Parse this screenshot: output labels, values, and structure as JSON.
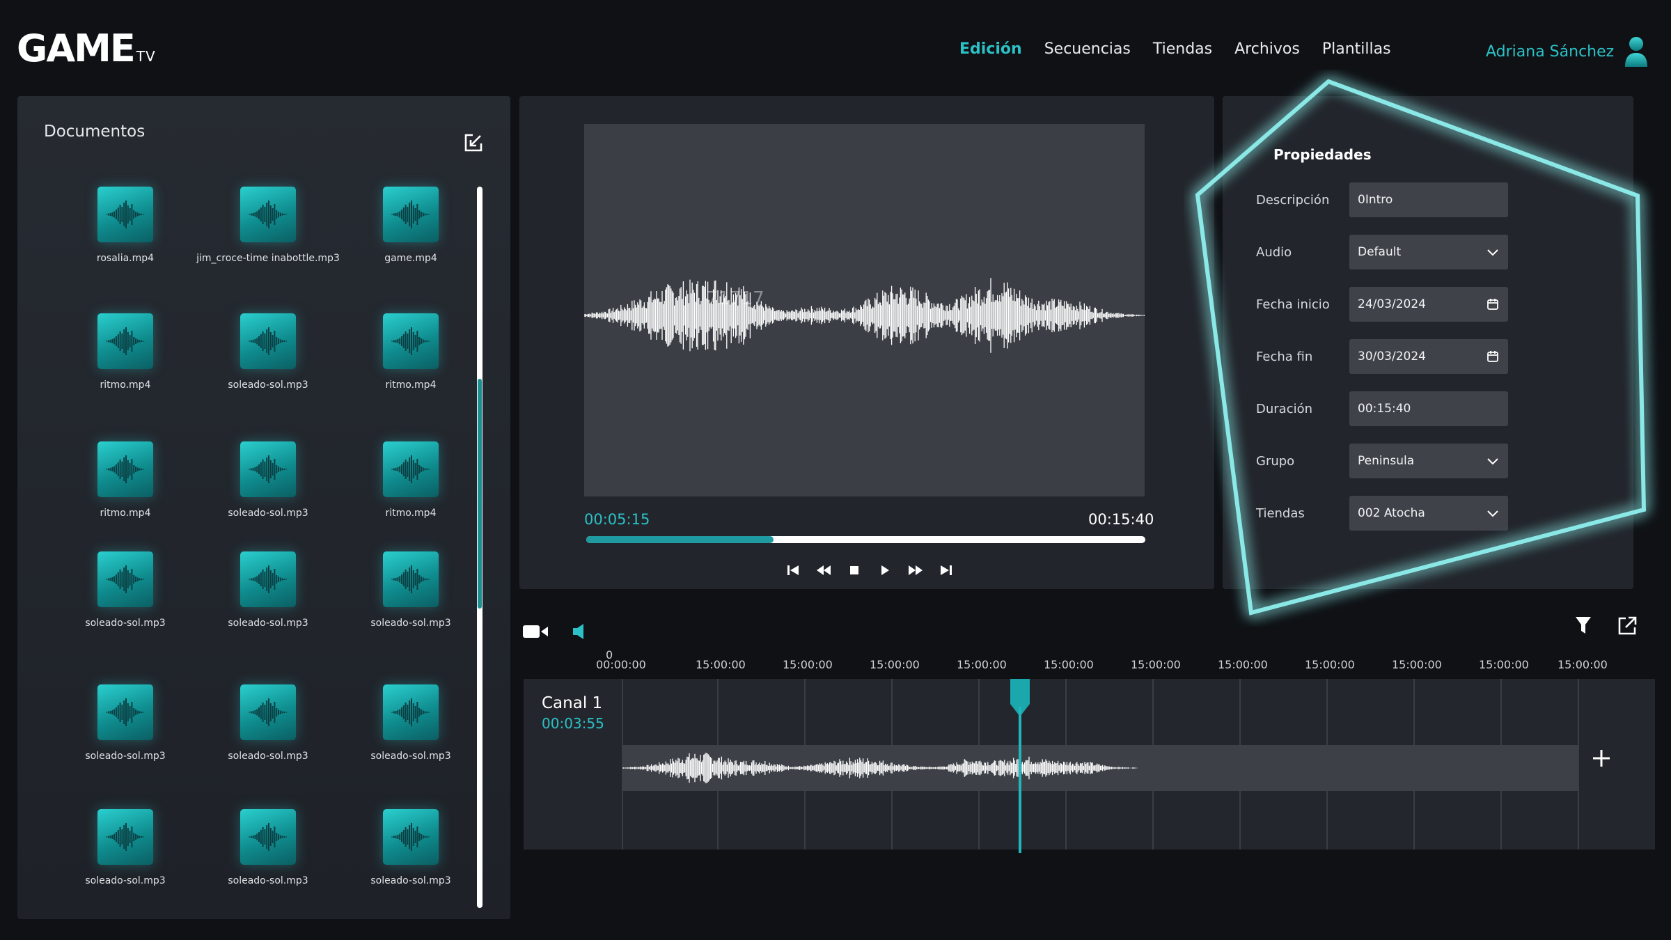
{
  "header": {
    "logo_main": "GAME",
    "logo_sub": "TV",
    "nav": [
      "Edición",
      "Secuencias",
      "Tiendas",
      "Archivos",
      "Plantillas"
    ],
    "active_nav": "Edición",
    "user_name": "Adriana Sánchez",
    "accent_color": "#2bc1c6"
  },
  "documents": {
    "title": "Documentos",
    "files": [
      "rosalia.mp4",
      "jim_croce-time inabottle.mp3",
      "game.mp4",
      "ritmo.mp4",
      "soleado-sol.mp3",
      "ritmo.mp4",
      "ritmo.mp4",
      "soleado-sol.mp3",
      "ritmo.mp4",
      "soleado-sol.mp3",
      "soleado-sol.mp3",
      "soleado-sol.mp3",
      "soleado-sol.mp3",
      "soleado-sol.mp3",
      "soleado-sol.mp3",
      "soleado-sol.mp3",
      "soleado-sol.mp3",
      "soleado-sol.mp3"
    ],
    "scroll_position": 0.27
  },
  "player": {
    "overlay_number": "71717",
    "current_time": "00:05:15",
    "total_time": "00:15:40",
    "progress": 0.335,
    "controls": [
      "skip-back-icon",
      "rewind-icon",
      "stop-icon",
      "play-icon",
      "fast-forward-icon",
      "skip-forward-icon"
    ]
  },
  "properties": {
    "title": "Propiedades",
    "rows": [
      {
        "label": "Descripción",
        "value": "0Intro",
        "type": "text"
      },
      {
        "label": "Audio",
        "value": "Default",
        "type": "select"
      },
      {
        "label": "Fecha inicio",
        "value": "24/03/2024",
        "type": "date"
      },
      {
        "label": "Fecha fin",
        "value": "30/03/2024",
        "type": "date"
      },
      {
        "label": "Duración",
        "value": "00:15:40",
        "type": "text"
      },
      {
        "label": "Grupo",
        "value": "Peninsula",
        "type": "select"
      },
      {
        "label": "Tiendas",
        "value": "002 Atocha",
        "type": "select"
      }
    ]
  },
  "timeline": {
    "zero_label": "0",
    "ticks": [
      "00:00:00",
      "15:00:00",
      "15:00:00",
      "15:00:00",
      "15:00:00",
      "15:00:00",
      "15:00:00",
      "15:00:00",
      "15:00:00",
      "15:00:00",
      "15:00:00",
      "15:00:00"
    ],
    "channel_name": "Canal 1",
    "channel_time": "00:03:55"
  }
}
